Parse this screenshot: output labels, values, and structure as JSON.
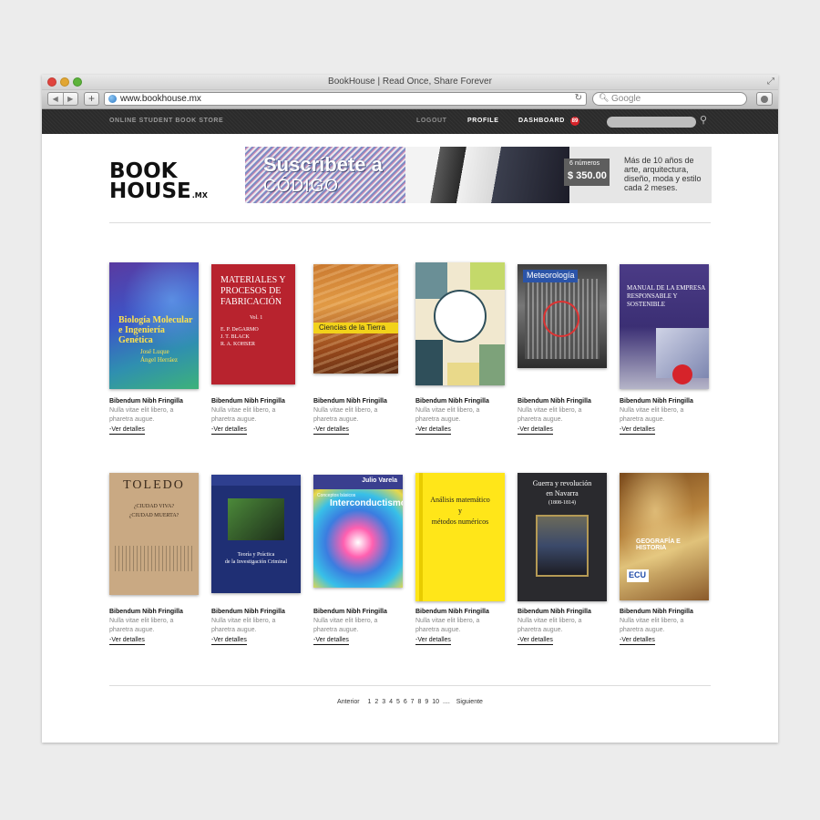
{
  "window": {
    "title": "BookHouse | Read Once, Share Forever"
  },
  "browser": {
    "url": "www.bookhouse.mx",
    "search_placeholder": "Google"
  },
  "sitenav": {
    "store_label": "ONLINE STUDENT BOOK STORE",
    "logout": "LOGOUT",
    "profile": "PROFILE",
    "dashboard": "DASHBOARD",
    "dashboard_badge": "89"
  },
  "logo": {
    "line1": "BOOK",
    "line2": "HOUSE",
    "suffix": ".MX"
  },
  "banner": {
    "title": "Suscríbete a",
    "brand": "CÓDIGO",
    "price_label": "6 números",
    "price": "$ 350.00",
    "text": "Más de 10 años de arte, arquitectura, diseño, moda y estilo cada 2 meses."
  },
  "books": [
    {
      "title": "Bibendum Nibh Fringilla",
      "desc": "Nulla vitae elit libero, a pharetra augue.",
      "link": "-Ver detalles",
      "cover_text": [
        "Biología Molecular",
        "e Ingeniería Genética",
        "José Luque",
        "Ángel Herráez"
      ]
    },
    {
      "title": "Bibendum Nibh Fringilla",
      "desc": "Nulla vitae elit libero, a pharetra augue.",
      "link": "-Ver detalles",
      "cover_text": [
        "MATERIALES Y",
        "PROCESOS DE",
        "FABRICACIÓN",
        "Vol. 1",
        "E. P. DeGARMO",
        "J. T. BLACK",
        "R. A. KOHSER"
      ]
    },
    {
      "title": "Bibendum Nibh Fringilla",
      "desc": "Nulla vitae elit libero, a pharetra augue.",
      "link": "-Ver detalles",
      "cover_text": [
        "Ciencias de la Tierra"
      ]
    },
    {
      "title": "Bibendum Nibh Fringilla",
      "desc": "Nulla vitae elit libero, a pharetra augue.",
      "link": "-Ver detalles",
      "cover_text": []
    },
    {
      "title": "Bibendum Nibh Fringilla",
      "desc": "Nulla vitae elit libero, a pharetra augue.",
      "link": "-Ver detalles",
      "cover_text": [
        "Meteorología"
      ]
    },
    {
      "title": "Bibendum Nibh Fringilla",
      "desc": "Nulla vitae elit libero, a pharetra augue.",
      "link": "-Ver detalles",
      "cover_text": [
        "MANUAL DE LA EMPRESA",
        "RESPONSABLE Y SOSTENIBLE"
      ]
    },
    {
      "title": "Bibendum Nibh Fringilla",
      "desc": "Nulla vitae elit libero, a pharetra augue.",
      "link": "-Ver detalles",
      "cover_text": [
        "TOLEDO",
        "¿CIUDAD VIVA?",
        "¿CIUDAD MUERTA?"
      ]
    },
    {
      "title": "Bibendum Nibh Fringilla",
      "desc": "Nulla vitae elit libero, a pharetra augue.",
      "link": "-Ver detalles",
      "cover_text": [
        "Teoría y Práctica",
        "de la Investigación Criminal"
      ]
    },
    {
      "title": "Bibendum Nibh Fringilla",
      "desc": "Nulla vitae elit libero, a pharetra augue.",
      "link": "-Ver detalles",
      "cover_text": [
        "Julio Varela",
        "Conceptos básicos",
        "Interconductismo"
      ]
    },
    {
      "title": "Bibendum Nibh Fringilla",
      "desc": "Nulla vitae elit libero, a pharetra augue.",
      "link": "-Ver detalles",
      "cover_text": [
        "Análisis matemático",
        "y",
        "métodos numéricos"
      ]
    },
    {
      "title": "Bibendum Nibh Fringilla",
      "desc": "Nulla vitae elit libero, a pharetra augue.",
      "link": "-Ver detalles",
      "cover_text": [
        "Guerra y revolución",
        "en Navarra",
        "(1808-1814)"
      ]
    },
    {
      "title": "Bibendum Nibh Fringilla",
      "desc": "Nulla vitae elit libero, a pharetra augue.",
      "link": "-Ver detalles",
      "cover_text": [
        "GEOGRAFÍA E HISTORIA",
        "ECU"
      ]
    }
  ],
  "pagination": {
    "prev": "Anterior",
    "pages": [
      "1",
      "2",
      "3",
      "4",
      "5",
      "6",
      "7",
      "8",
      "9",
      "10"
    ],
    "ellipsis": "....",
    "next": "Siguiente"
  }
}
